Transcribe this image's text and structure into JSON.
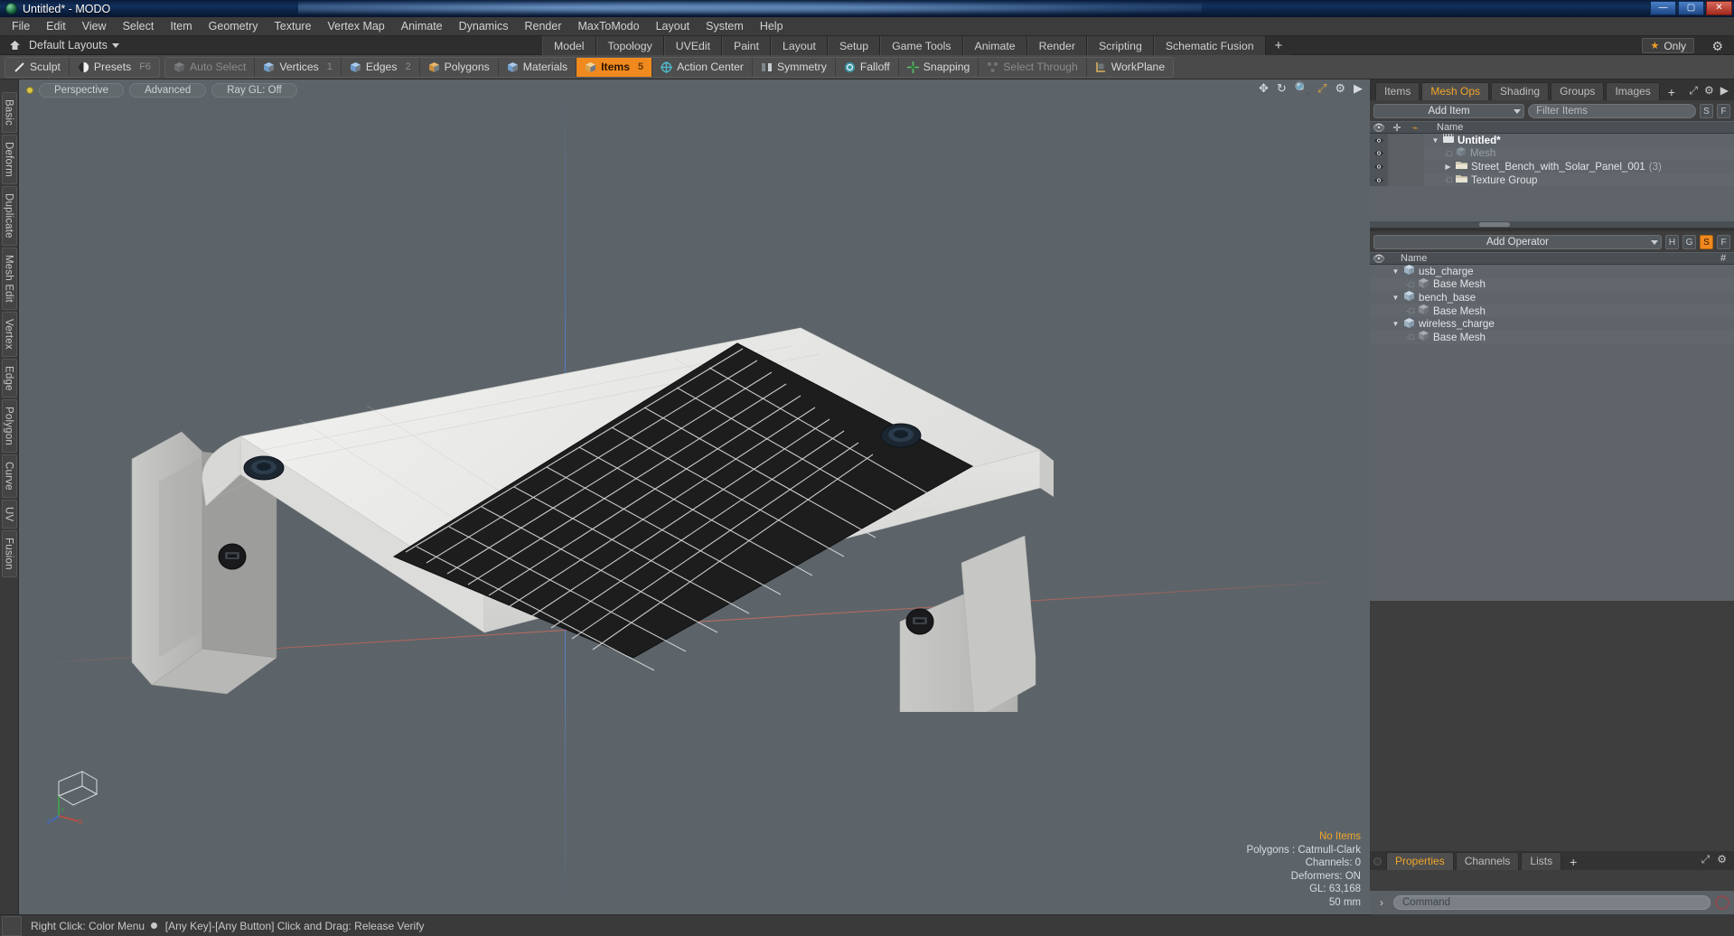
{
  "window": {
    "title": "Untitled* - MODO",
    "app_icon": "modo-logo-icon",
    "minimize": "—",
    "maximize": "▢",
    "close": "✕"
  },
  "menubar": {
    "items": [
      "File",
      "Edit",
      "View",
      "Select",
      "Item",
      "Geometry",
      "Texture",
      "Vertex Map",
      "Animate",
      "Dynamics",
      "Render",
      "MaxToModo",
      "Layout",
      "System",
      "Help"
    ]
  },
  "layout_row": {
    "home_icon": "home-icon",
    "default_layouts": "Default Layouts",
    "tabs": [
      {
        "label": "Model",
        "active": true
      },
      {
        "label": "Topology",
        "active": false
      },
      {
        "label": "UVEdit",
        "active": false
      },
      {
        "label": "Paint",
        "active": false
      },
      {
        "label": "Layout",
        "active": false
      },
      {
        "label": "Setup",
        "active": false
      },
      {
        "label": "Game Tools",
        "active": false
      },
      {
        "label": "Animate",
        "active": false
      },
      {
        "label": "Render",
        "active": false
      },
      {
        "label": "Scripting",
        "active": false
      },
      {
        "label": "Schematic Fusion",
        "active": false
      }
    ],
    "add_tab": "+",
    "only_label": "Only",
    "star_icon": "star-icon",
    "gear_icon": "gear-icon"
  },
  "modebar": {
    "group1": [
      {
        "label": "Sculpt",
        "icon": "pencil-icon",
        "shortcut": "",
        "state": "normal"
      },
      {
        "label": "Presets",
        "icon": "sphere-icon",
        "shortcut": "F6",
        "state": "normal"
      }
    ],
    "group2": [
      {
        "label": "Auto Select",
        "icon": "cube-grey-icon",
        "shortcut": "",
        "state": "dim"
      },
      {
        "label": "Vertices",
        "icon": "cube-vertex-icon",
        "shortcut": "1",
        "state": "normal"
      },
      {
        "label": "Edges",
        "icon": "cube-edge-icon",
        "shortcut": "2",
        "state": "normal"
      },
      {
        "label": "Polygons",
        "icon": "cube-poly-icon",
        "shortcut": "",
        "state": "normal"
      },
      {
        "label": "Materials",
        "icon": "cube-material-icon",
        "shortcut": "",
        "state": "normal"
      },
      {
        "label": "Items",
        "icon": "cube-item-icon",
        "shortcut": "5",
        "state": "active"
      },
      {
        "label": "Action Center",
        "icon": "crosshair-icon",
        "shortcut": "",
        "state": "normal"
      },
      {
        "label": "Symmetry",
        "icon": "symmetry-icon",
        "shortcut": "",
        "state": "normal"
      },
      {
        "label": "Falloff",
        "icon": "falloff-icon",
        "shortcut": "",
        "state": "normal"
      },
      {
        "label": "Snapping",
        "icon": "snap-icon",
        "shortcut": "",
        "state": "normal"
      },
      {
        "label": "Select Through",
        "icon": "select-through-icon",
        "shortcut": "",
        "state": "dim"
      },
      {
        "label": "WorkPlane",
        "icon": "workplane-icon",
        "shortcut": "",
        "state": "normal"
      }
    ]
  },
  "left_tabs": [
    "Basic",
    "Deform",
    "Duplicate",
    "Mesh Edit",
    "Vertex",
    "Edge",
    "Polygon",
    "Curve",
    "UV",
    "Fusion"
  ],
  "viewport": {
    "indicator_dot": "viewport-active-dot",
    "buttons": [
      "Perspective",
      "Advanced",
      "Ray GL: Off"
    ],
    "tool_icons": [
      "move-icon",
      "rotate-icon",
      "zoom-icon",
      "fit-icon",
      "gear-icon",
      "expand-arrow-icon"
    ],
    "stats": {
      "items": "No Items",
      "polygons": "Polygons : Catmull-Clark",
      "channels": "Channels: 0",
      "deformers": "Deformers: ON",
      "gl": "GL: 63,168",
      "scale": "50 mm"
    },
    "gizmo": {
      "x": "X",
      "y": "Y",
      "z": "Z"
    }
  },
  "right_panel": {
    "top_tabs": [
      {
        "label": "Items",
        "active": false
      },
      {
        "label": "Mesh Ops",
        "active": true
      },
      {
        "label": "Shading",
        "active": false
      },
      {
        "label": "Groups",
        "active": false
      },
      {
        "label": "Images",
        "active": false
      }
    ],
    "add_tab": "+",
    "panel_icons": [
      "expand-icon",
      "gear-icon",
      "chevron-right-icon"
    ],
    "add_item_label": "Add Item",
    "filter_placeholder": "Filter Items",
    "item_buttons": [
      "S",
      "F"
    ],
    "item_header": {
      "eye": "eye-icon",
      "lock": "pin-icon",
      "shape": "curve-icon",
      "name": "Name"
    },
    "items": [
      {
        "name": "Untitled*",
        "icon": "scene-icon",
        "depth": 0,
        "twisty": "open",
        "bold": true,
        "dim": false,
        "count": ""
      },
      {
        "name": "Mesh",
        "icon": "mesh-icon",
        "depth": 1,
        "twisty": "dot",
        "bold": false,
        "dim": true,
        "count": ""
      },
      {
        "name": "Street_Bench_with_Solar_Panel_001",
        "icon": "group-icon",
        "depth": 1,
        "twisty": "closed",
        "bold": false,
        "dim": false,
        "count": "(3)"
      },
      {
        "name": "Texture Group",
        "icon": "group-icon",
        "depth": 1,
        "twisty": "dot",
        "bold": false,
        "dim": false,
        "count": ""
      }
    ],
    "add_operator_label": "Add Operator",
    "operator_buttons": [
      {
        "label": "H",
        "active": false
      },
      {
        "label": "G",
        "active": false
      },
      {
        "label": "S",
        "active": true
      },
      {
        "label": "F",
        "active": false
      }
    ],
    "operator_header": {
      "eye": "eye-icon",
      "name": "Name",
      "hash": "#"
    },
    "operators": [
      {
        "name": "usb_charge",
        "icon": "mesh-blue-icon",
        "depth": 0,
        "twisty": "open"
      },
      {
        "name": "Base Mesh",
        "icon": "mesh-grey-icon",
        "depth": 1,
        "twisty": "dot"
      },
      {
        "name": "bench_base",
        "icon": "mesh-blue-icon",
        "depth": 0,
        "twisty": "open"
      },
      {
        "name": "Base Mesh",
        "icon": "mesh-grey-icon",
        "depth": 1,
        "twisty": "dot"
      },
      {
        "name": "wireless_charge",
        "icon": "mesh-blue-icon",
        "depth": 0,
        "twisty": "open"
      },
      {
        "name": "Base Mesh",
        "icon": "mesh-grey-icon",
        "depth": 1,
        "twisty": "dot"
      }
    ],
    "bottom_tabs": [
      {
        "label": "Properties",
        "active": true
      },
      {
        "label": "Channels",
        "active": false
      },
      {
        "label": "Lists",
        "active": false
      }
    ],
    "bottom_add_tab": "+",
    "command_placeholder": "Command",
    "command_chevron": "›",
    "record_icon": "record-icon"
  },
  "statusbar": {
    "text_a": "Right Click: Color Menu",
    "bullet": "●",
    "text_b": "[Any Key]-[Any Button] Click and Drag: Release Verify"
  },
  "colors": {
    "accent_orange": "#f0891e",
    "highlight_orange": "#f0a52a",
    "panel_bg": "#3e3e3e",
    "viewport_bg": "#5c6469",
    "tree_bg": "#5e646a"
  }
}
